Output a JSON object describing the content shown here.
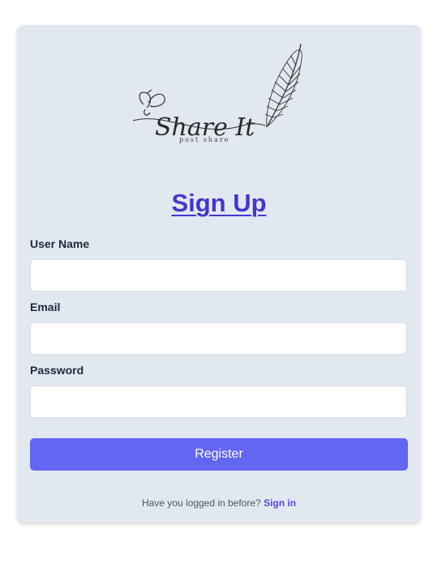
{
  "logo": {
    "brand": "Share It",
    "tagline": "post share"
  },
  "form": {
    "title": "Sign Up",
    "fields": [
      {
        "label": "User Name",
        "value": "",
        "placeholder": ""
      },
      {
        "label": "Email",
        "value": "",
        "placeholder": ""
      },
      {
        "label": "Password",
        "value": "",
        "placeholder": ""
      }
    ],
    "submit_label": "Register"
  },
  "footer": {
    "prompt": "Have you logged in before?",
    "link_label": "Sign in"
  },
  "colors": {
    "card_background": "#e2e8f0",
    "title_color": "#4338ca",
    "button_color": "#6366f1",
    "link_color": "#4f46e5"
  }
}
